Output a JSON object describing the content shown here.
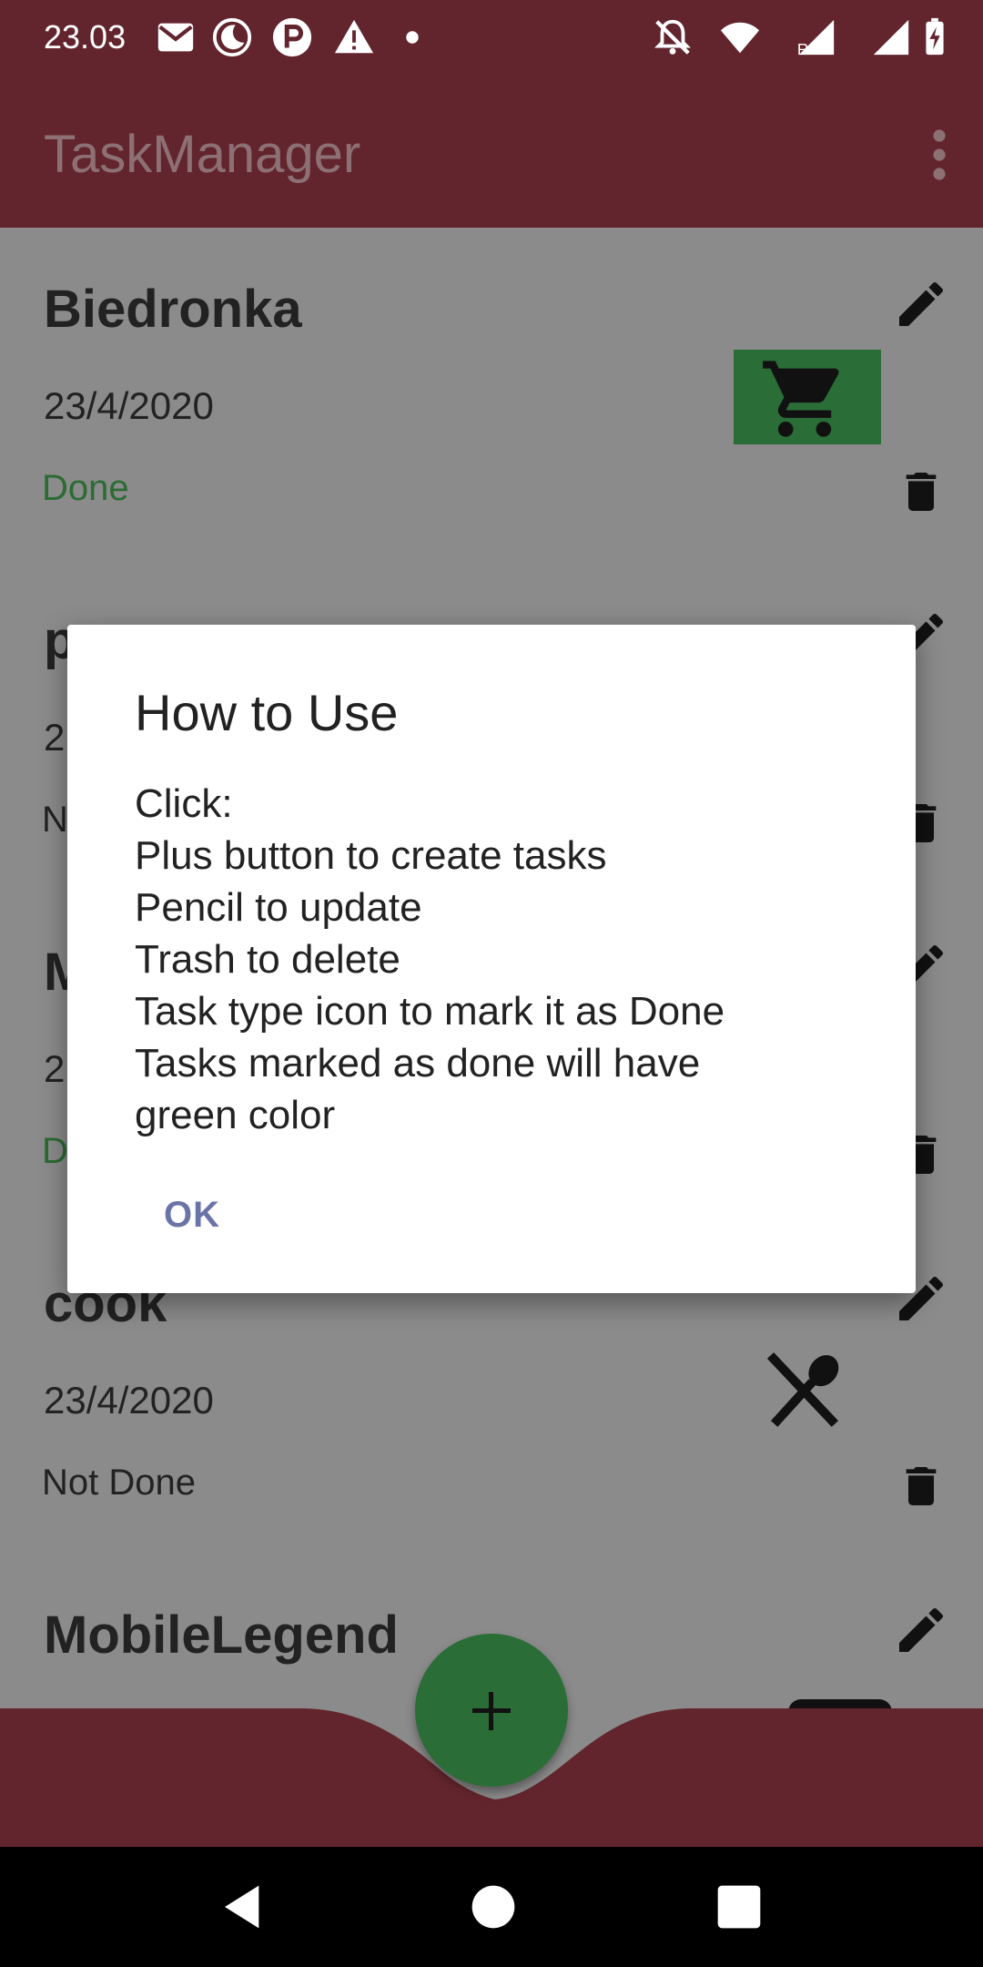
{
  "status_bar": {
    "time": "23.03",
    "icons": [
      "gmail-icon",
      "moon-icon",
      "p-icon",
      "warning-icon",
      "dot-icon",
      "bell-off-icon",
      "wifi-icon",
      "signal-roaming-icon",
      "signal-icon",
      "battery-charging-icon"
    ]
  },
  "app_bar": {
    "title": "TaskManager",
    "menu_icon": "more-vert-icon"
  },
  "tasks": [
    {
      "name": "Biedronka",
      "date": "23/4/2020",
      "status": "Done",
      "type_icon": "cart-icon",
      "done": true
    },
    {
      "name": "p",
      "date": "2",
      "status": "N",
      "type_icon": "",
      "done": false
    },
    {
      "name": "M",
      "date": "2",
      "status": "D",
      "type_icon": "",
      "done": true
    },
    {
      "name": "cook",
      "date": "23/4/2020",
      "status": "Not Done",
      "type_icon": "utensils-icon",
      "done": false
    },
    {
      "name": "MobileLegend",
      "date": "",
      "status": "",
      "type_icon": "gamepad-icon",
      "done": false
    }
  ],
  "dialog": {
    "title": "How to Use",
    "lines": [
      "Click:",
      "Plus button to create tasks",
      "Pencil to update",
      "Trash to delete",
      "Task type icon to mark it as Done",
      "Tasks marked as done will have",
      "green color"
    ],
    "ok_label": "OK"
  },
  "fab": {
    "icon": "plus-icon"
  },
  "nav_bar": {
    "icons": [
      "back-icon",
      "home-icon",
      "recents-icon"
    ]
  },
  "colors": {
    "primary": "#63252d",
    "accent": "#2a6d37",
    "dialog_button": "#6b74a6",
    "scrim_background": "#8b8b8b"
  }
}
